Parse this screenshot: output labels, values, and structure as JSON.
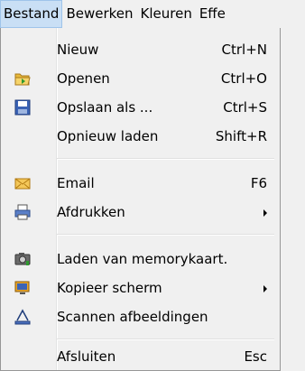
{
  "menubar": {
    "items": [
      "Bestand",
      "Bewerken",
      "Kleuren",
      "Effe"
    ]
  },
  "menu": {
    "items": [
      {
        "label": "Nieuw",
        "shortcut": "Ctrl+N",
        "icon": "none"
      },
      {
        "label": "Openen",
        "shortcut": "Ctrl+O",
        "icon": "open-folder-icon"
      },
      {
        "label": "Opslaan als ...",
        "shortcut": "Ctrl+S",
        "icon": "save-icon"
      },
      {
        "label": "Opnieuw laden",
        "shortcut": "Shift+R",
        "icon": "none"
      },
      {
        "label": "Email",
        "shortcut": "F6",
        "icon": "email-icon"
      },
      {
        "label": "Afdrukken",
        "shortcut": "",
        "icon": "printer-icon",
        "submenu": true
      },
      {
        "label": "Laden van memorykaart.",
        "shortcut": "",
        "icon": "camera-icon"
      },
      {
        "label": "Kopieer scherm",
        "shortcut": "",
        "icon": "screen-copy-icon",
        "submenu": true
      },
      {
        "label": "Scannen afbeeldingen",
        "shortcut": "",
        "icon": "scanner-icon"
      },
      {
        "label": "Afsluiten",
        "shortcut": "Esc",
        "icon": "none"
      }
    ]
  }
}
